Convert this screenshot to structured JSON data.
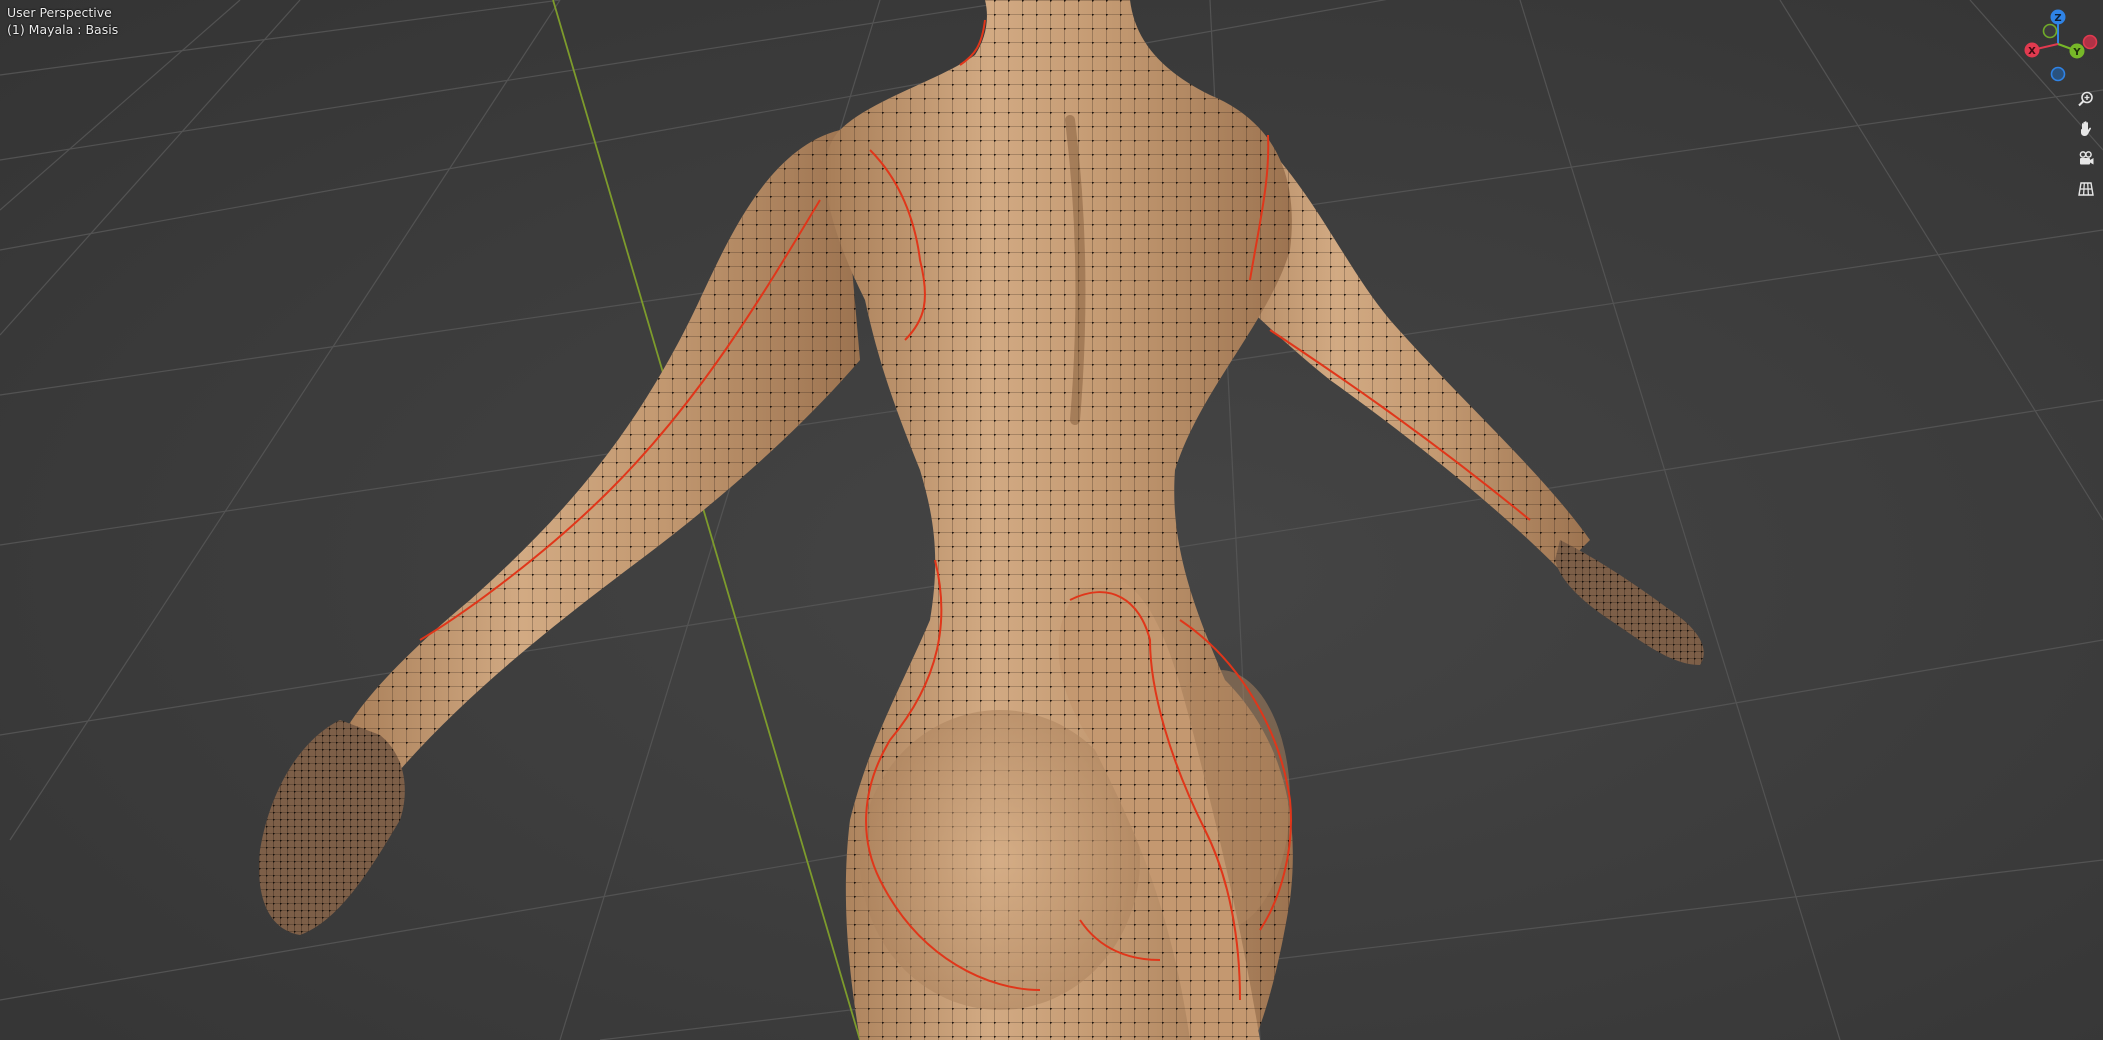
{
  "viewport": {
    "view_name": "User Perspective",
    "object_info": "(1) Mayala : Basis"
  },
  "gizmo": {
    "axes": [
      {
        "label": "Z",
        "color": "#2f83e6"
      },
      {
        "label": "Y",
        "color": "#77b828"
      },
      {
        "label": "X",
        "color": "#e13a4f"
      }
    ],
    "negative_axes": [
      {
        "label": "-Y",
        "color": "#77b828"
      },
      {
        "label": "-X",
        "color": "#e13a4f"
      },
      {
        "label": "-Z",
        "color": "#2f83e6"
      }
    ]
  },
  "navigation": [
    {
      "name": "zoom",
      "icon": "zoom-icon"
    },
    {
      "name": "pan",
      "icon": "hand-icon"
    },
    {
      "name": "camera-view",
      "icon": "camera-icon"
    },
    {
      "name": "ortho-toggle",
      "icon": "grid-icon"
    }
  ],
  "colors": {
    "background": "#3d3d3d",
    "grid_line": "#555555",
    "y_axis_line": "#7a9a2e",
    "skin": "#c8a07a",
    "wire": "#1a1410",
    "seam": "#e03a1a"
  }
}
